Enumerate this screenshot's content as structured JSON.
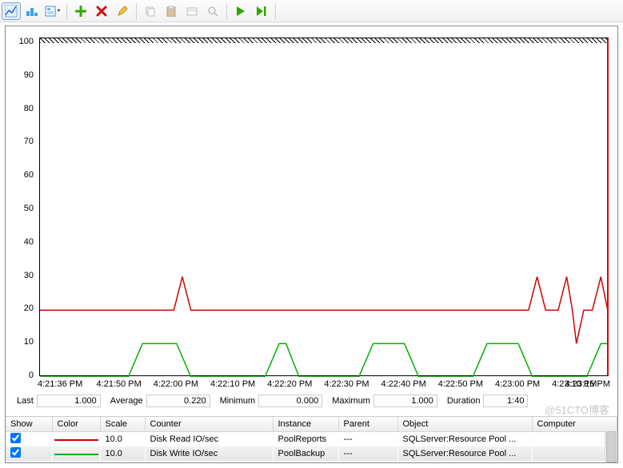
{
  "toolbar": {
    "view_graph": "View chart",
    "view_histogram": "View histogram",
    "view_report": "View report",
    "add_counter": "Add counters",
    "remove_counter": "Delete",
    "highlight": "Highlight",
    "copy": "Copy",
    "paste": "Paste",
    "properties": "Properties",
    "zoom": "Zoom",
    "freeze": "Freeze Display",
    "update": "Update Data"
  },
  "chart_data": {
    "type": "line",
    "ylim": [
      0,
      100
    ],
    "yticks": [
      0,
      10,
      20,
      30,
      40,
      50,
      60,
      70,
      80,
      90,
      100
    ],
    "xticks": [
      "4:21:36 PM",
      "4:21:50 PM",
      "4:22:00 PM",
      "4:22:10 PM",
      "4:22:20 PM",
      "4:22:30 PM",
      "4:22:40 PM",
      "4:22:50 PM",
      "4:23:00 PM",
      "4:23:10 PM",
      "4:23:15 PM"
    ],
    "scan_x_frac": 0.997,
    "series": [
      {
        "name": "Disk Read IO/sec",
        "color": "#d00000",
        "points": [
          [
            0.0,
            20
          ],
          [
            0.235,
            20
          ],
          [
            0.25,
            30
          ],
          [
            0.265,
            20
          ],
          [
            0.858,
            20
          ],
          [
            0.873,
            30
          ],
          [
            0.888,
            20
          ],
          [
            0.91,
            20
          ],
          [
            0.925,
            30
          ],
          [
            0.935,
            20
          ],
          [
            0.942,
            10
          ],
          [
            0.955,
            20
          ],
          [
            0.97,
            20
          ],
          [
            0.985,
            30
          ],
          [
            0.997,
            20
          ]
        ]
      },
      {
        "name": "Disk Write IO/sec",
        "color": "#00b000",
        "points": [
          [
            0.0,
            0
          ],
          [
            0.155,
            0
          ],
          [
            0.18,
            10
          ],
          [
            0.24,
            10
          ],
          [
            0.265,
            0
          ],
          [
            0.395,
            0
          ],
          [
            0.42,
            10
          ],
          [
            0.432,
            10
          ],
          [
            0.455,
            0
          ],
          [
            0.56,
            0
          ],
          [
            0.585,
            10
          ],
          [
            0.64,
            10
          ],
          [
            0.665,
            0
          ],
          [
            0.76,
            0
          ],
          [
            0.785,
            10
          ],
          [
            0.84,
            10
          ],
          [
            0.865,
            0
          ],
          [
            0.96,
            0
          ],
          [
            0.985,
            10
          ],
          [
            0.997,
            10
          ]
        ]
      }
    ]
  },
  "stats": {
    "last_label": "Last",
    "last": "1.000",
    "avg_label": "Average",
    "avg": "0.220",
    "min_label": "Minimum",
    "min": "0.000",
    "max_label": "Maximum",
    "max": "1.000",
    "dur_label": "Duration",
    "dur": "1:40"
  },
  "legend": {
    "columns": [
      "Show",
      "Color",
      "Scale",
      "Counter",
      "Instance",
      "Parent",
      "Object",
      "Computer"
    ],
    "rows": [
      {
        "show": true,
        "color": "#d00000",
        "scale": "10.0",
        "counter": "Disk Read IO/sec",
        "instance": "PoolReports",
        "parent": "---",
        "object": "SQLServer:Resource Pool ...",
        "computer": ""
      },
      {
        "show": true,
        "color": "#00b000",
        "scale": "10.0",
        "counter": "Disk Write IO/sec",
        "instance": "PoolBackup",
        "parent": "---",
        "object": "SQLServer:Resource Pool ...",
        "computer": ""
      }
    ]
  },
  "watermark": "@51CTO博客"
}
